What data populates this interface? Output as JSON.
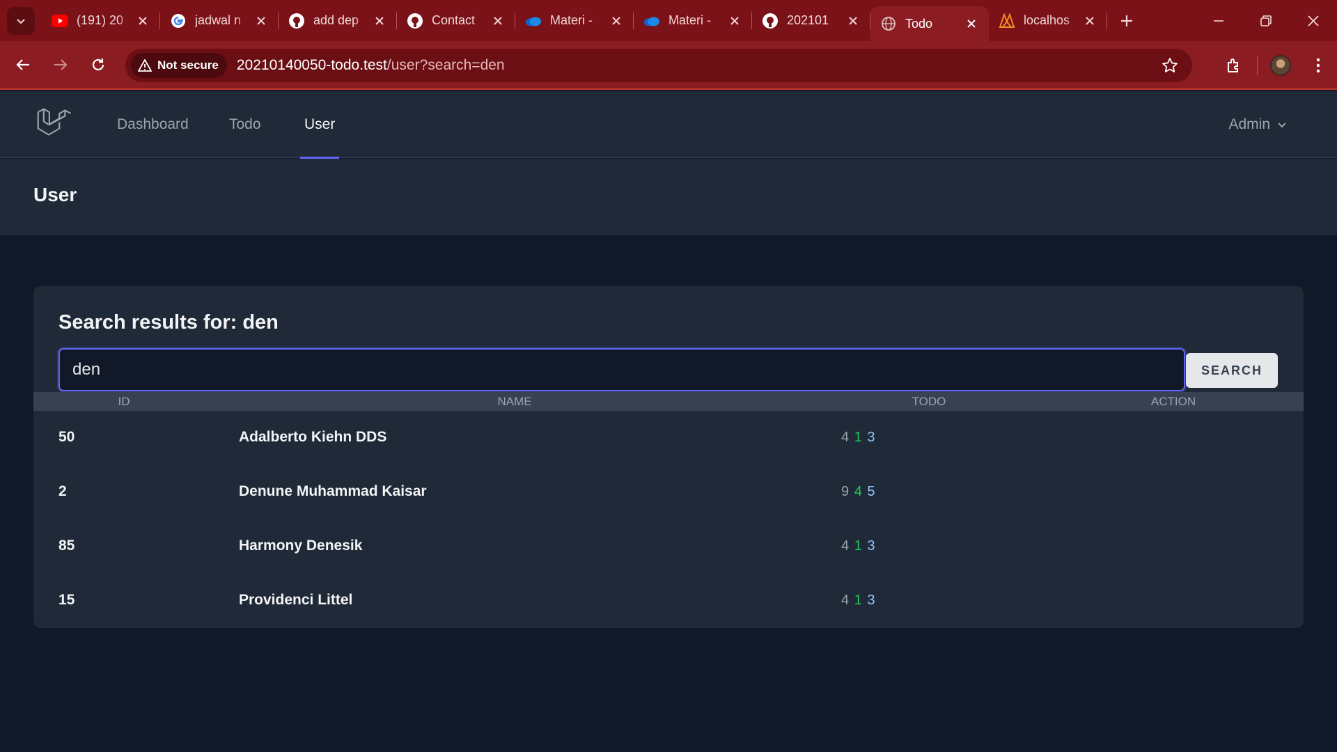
{
  "browser": {
    "tabs": [
      {
        "title": "(191) 20",
        "icon": "youtube-icon",
        "active": false
      },
      {
        "title": "jadwal n",
        "icon": "google-icon",
        "active": false
      },
      {
        "title": "add dep",
        "icon": "github-icon",
        "active": false
      },
      {
        "title": "Contact",
        "icon": "github-icon",
        "active": false
      },
      {
        "title": "Materi -",
        "icon": "onedrive-icon",
        "active": false
      },
      {
        "title": "Materi -",
        "icon": "onedrive-icon",
        "active": false
      },
      {
        "title": "202101",
        "icon": "github-icon",
        "active": false
      },
      {
        "title": "Todo",
        "icon": "globe-icon",
        "active": true
      },
      {
        "title": "localhos",
        "icon": "xampp-icon",
        "active": false
      }
    ],
    "security_label": "Not secure",
    "url_host": "20210140050-todo.test",
    "url_path": "/user?search=den"
  },
  "nav": {
    "links": [
      "Dashboard",
      "Todo",
      "User"
    ],
    "active": "User",
    "user_menu": "Admin"
  },
  "page": {
    "title": "User"
  },
  "search": {
    "heading": "Search results for: den",
    "value": "den",
    "button_label": "SEARCH"
  },
  "table": {
    "headers": [
      "ID",
      "NAME",
      "TODO",
      "ACTION"
    ],
    "rows": [
      {
        "id": "50",
        "name": "Adalberto Kiehn DDS",
        "todo": [
          "4",
          "1",
          "3"
        ]
      },
      {
        "id": "2",
        "name": "Denune Muhammad Kaisar",
        "todo": [
          "9",
          "4",
          "5"
        ]
      },
      {
        "id": "85",
        "name": "Harmony Denesik",
        "todo": [
          "4",
          "1",
          "3"
        ]
      },
      {
        "id": "15",
        "name": "Providenci Littel",
        "todo": [
          "4",
          "1",
          "3"
        ]
      }
    ]
  },
  "colors": {
    "browser_frame": "#7a1218",
    "toolbar": "#8b1c22",
    "app_bg": "#111827",
    "panel": "#1f2937",
    "accent": "#6366f1",
    "todo_done": "#22c55e",
    "todo_pending": "#93c5fd"
  }
}
